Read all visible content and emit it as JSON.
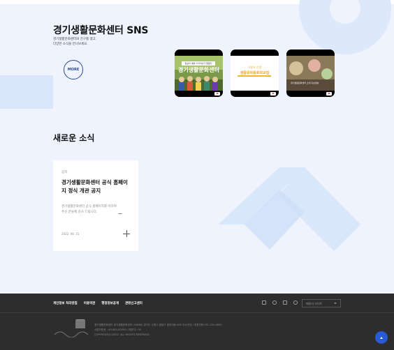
{
  "sns": {
    "title": "경기생활문화센터 SNS",
    "desc_line1": "경기생활문화센터와 친구를 맺고",
    "desc_line2": "다양한 소식을 만나보세요.",
    "more_label": "MORE",
    "thumb1_top": "일상이 예술 디자이너가 말했다",
    "thumb1_main": "경기생활문화센터",
    "thumb2_top": "가을의 운영",
    "thumb2_main": "생활문화동호회모집",
    "thumb3_caption": "경기생활문화센터 소개 홍보영상"
  },
  "news": {
    "section_title": "새로운 소식",
    "category": "공지",
    "headline": "경기생활문화센터 공식 홈페이지 정식 개관 공지",
    "body": "경기생활문화센터 공식 홈페이지를 이다려주신 분들께 감사 드립니다.",
    "date": "2022. 09. 31"
  },
  "footer": {
    "links": [
      "개인정보 처리방침",
      "이용약관",
      "행정정보공개",
      "관련신고센터"
    ],
    "family_site_placeholder": "패밀리 사이트",
    "info_line1": "경기생활문화센터 경기생활문화센터 (16480) 경기도 수원시 팔달구 중부대로 000 주소안내 / 대표전화 031-231-0600",
    "info_line2": "사업자번호 : 00-000-00000 / 대표자 : 00",
    "info_line3": "COPYRIGHT(c)2022. ALL RIGHTS RESERVED.",
    "sns_icons": [
      "facebook-icon",
      "instagram-icon",
      "youtube-icon",
      "blog-icon"
    ]
  },
  "colors": {
    "accent": "#2a5bd7",
    "background": "#eef3fd",
    "footer_bg": "#2d2d2d"
  }
}
